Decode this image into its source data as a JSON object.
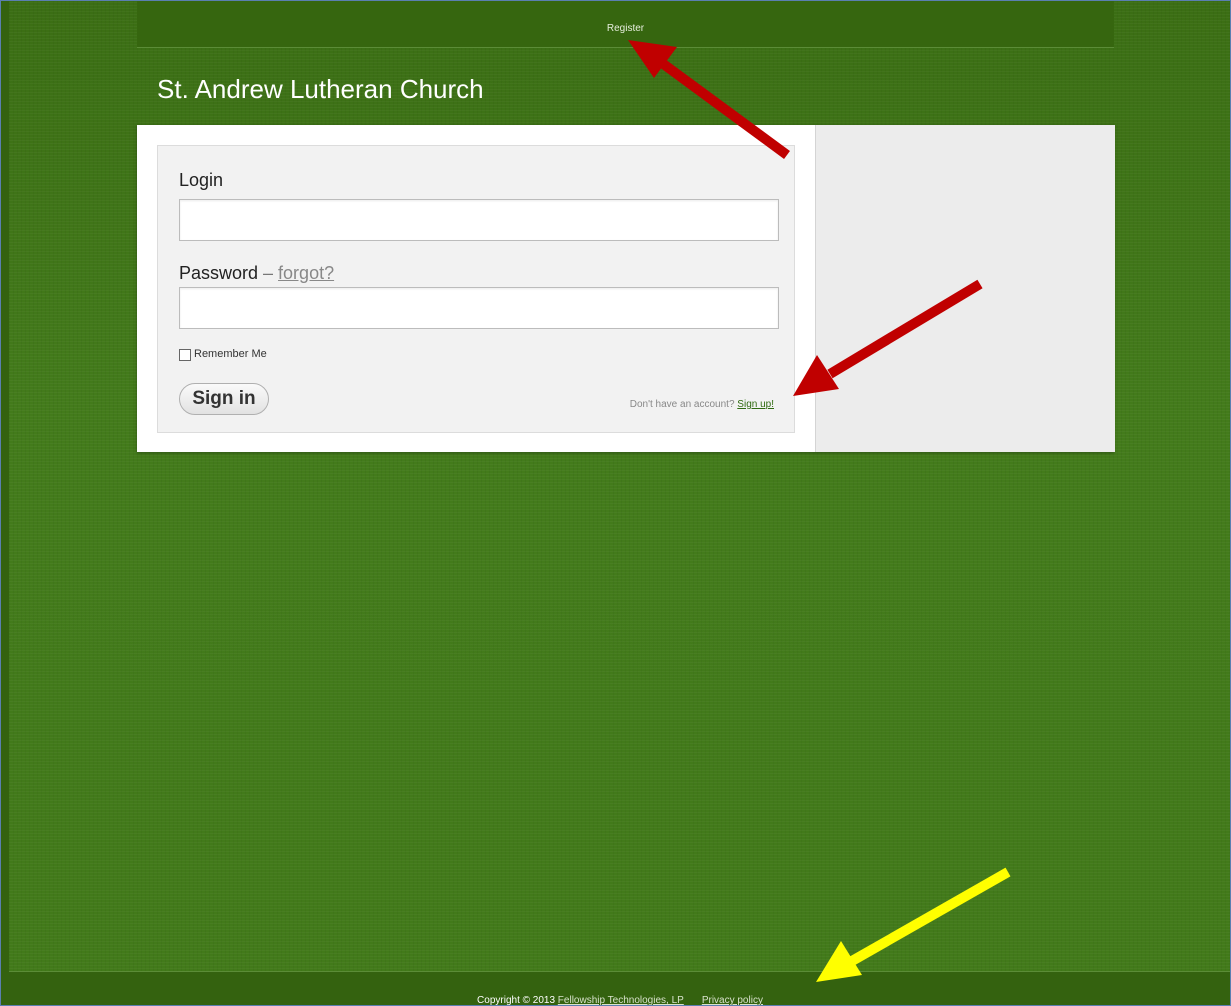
{
  "topbar": {
    "register_label": "Register"
  },
  "site": {
    "title": "St. Andrew Lutheran Church"
  },
  "login_form": {
    "login_label": "Login",
    "login_value": "",
    "password_label": "Password",
    "password_separator": " – ",
    "forgot_label": "forgot?",
    "password_value": "",
    "remember_label": "Remember Me",
    "remember_checked": false,
    "signin_label": "Sign in",
    "no_account_text": "Don't have an account? ",
    "signup_label": "Sign up!"
  },
  "footer": {
    "copyright_text": "Copyright © 2013 ",
    "company_link": "Fellowship Technologies, LP",
    "privacy_link": "Privacy policy"
  },
  "annotations": {
    "arrow_colors": [
      "#c00000",
      "#c00000",
      "#ffff00"
    ]
  },
  "colors": {
    "background_green": "#427a1a",
    "link_green": "#2f6a10",
    "panel_gray": "#ececec"
  }
}
